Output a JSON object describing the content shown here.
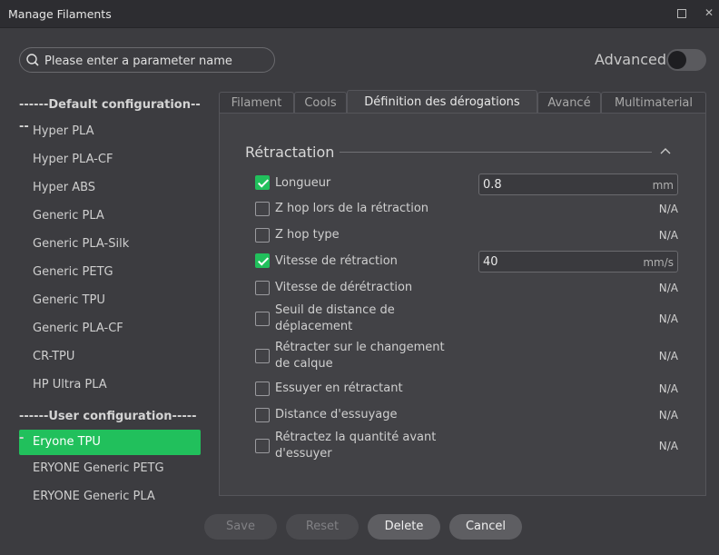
{
  "window": {
    "title": "Manage Filaments"
  },
  "search": {
    "placeholder": "Please enter a parameter name"
  },
  "advanced": {
    "label": "Advanced",
    "enabled": false
  },
  "sidebar": {
    "default_header": "------Default configuration----",
    "default_items": [
      "Hyper PLA",
      "Hyper PLA-CF",
      "Hyper ABS",
      "Generic PLA",
      "Generic PLA-Silk",
      "Generic PETG",
      "Generic TPU",
      "Generic PLA-CF",
      "CR-TPU",
      "HP Ultra PLA"
    ],
    "user_header": "------User configuration------",
    "user_items": [
      "Eryone TPU",
      "ERYONE Generic PETG",
      "ERYONE Generic PLA"
    ],
    "selected": "Eryone TPU"
  },
  "tabs": [
    {
      "label": "Filament",
      "active": false
    },
    {
      "label": "Cools",
      "active": false
    },
    {
      "label": "Définition des dérogations",
      "active": true
    },
    {
      "label": "Avancé",
      "active": false
    },
    {
      "label": "Multimaterial",
      "active": false
    }
  ],
  "group": {
    "title": "Rétractation"
  },
  "rows": [
    {
      "label": "Longueur",
      "checked": true,
      "value": "0.8",
      "unit": "mm"
    },
    {
      "label": "Z hop lors de la rétraction",
      "checked": false,
      "na": "N/A"
    },
    {
      "label": "Z hop type",
      "checked": false,
      "na": "N/A"
    },
    {
      "label": "Vitesse de rétraction",
      "checked": true,
      "value": "40",
      "unit": "mm/s"
    },
    {
      "label": "Vitesse de dérétraction",
      "checked": false,
      "na": "N/A"
    },
    {
      "label": "Seuil de distance de déplacement",
      "checked": false,
      "na": "N/A"
    },
    {
      "label": "Rétracter sur le changement de calque",
      "checked": false,
      "na": "N/A"
    },
    {
      "label": "Essuyer en rétractant",
      "checked": false,
      "na": "N/A"
    },
    {
      "label": "Distance d'essuyage",
      "checked": false,
      "na": "N/A"
    },
    {
      "label": "Rétractez la quantité avant d'essuyer",
      "checked": false,
      "na": "N/A"
    }
  ],
  "buttons": {
    "save": "Save",
    "reset": "Reset",
    "delete": "Delete",
    "cancel": "Cancel"
  },
  "colors": {
    "accent": "#21c05c",
    "background": "#3c3c40",
    "panel": "#424246"
  }
}
